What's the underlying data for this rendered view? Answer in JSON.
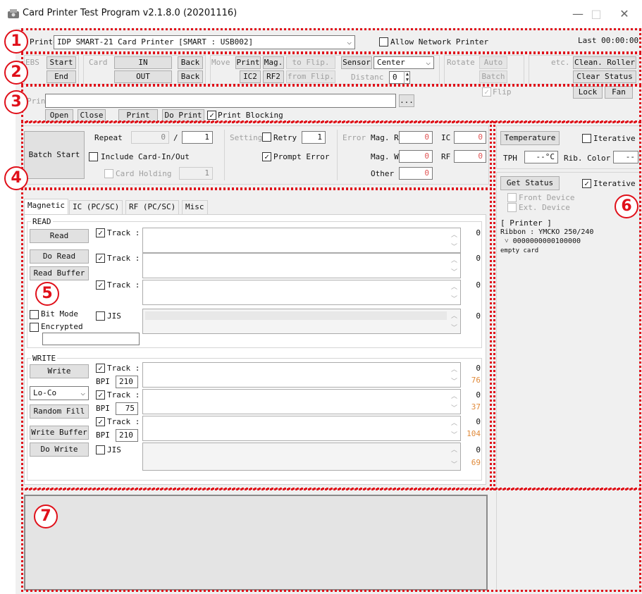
{
  "window": {
    "title": "Card Printer Test Program v2.1.8.0 (20201116)",
    "minimize": "—",
    "maximize": "□",
    "close": "✕"
  },
  "printer_row": {
    "label": "Printer",
    "printer_value": "IDP SMART-21 Card Printer  [SMART : USB002]",
    "allow_network": "Allow Network Printer",
    "last": "Last 00:00:00"
  },
  "row2": {
    "ebs": "EBS",
    "start": "Start",
    "end": "End",
    "card": "Card",
    "in": "IN",
    "out": "OUT",
    "back1": "Back",
    "back2": "Back",
    "move": "Move",
    "print": "Print",
    "mag": "Mag.",
    "to_flip": "to Flip.",
    "ic2": "IC2",
    "rf2": "RF2",
    "from_flip": "from Flip.",
    "sensor": "Sensor",
    "sensor_value": "Center",
    "distance": "Distanc",
    "distance_value": "0",
    "rotate": "Rotate",
    "auto": "Auto",
    "batch": "Batch",
    "flip": "Flip",
    "etc": "etc.",
    "clean_roller": "Clean. Roller",
    "clear_status": "Clear Status",
    "lock": "Lock",
    "fan": "Fan"
  },
  "row3": {
    "label": "Prin",
    "browse": "...",
    "open": "Open",
    "close": "Close",
    "print": "Print",
    "do_print": "Do Print",
    "print_blocking": "Print Blocking"
  },
  "batch": {
    "batch_start": "Batch Start",
    "repeat": "Repeat",
    "repeat_done": "0",
    "slash": "/",
    "repeat_total": "1",
    "include_card": "Include Card-In/Out",
    "card_holding": "Card Holding",
    "card_holding_value": "1",
    "setting": "Setting",
    "retry": "Retry",
    "retry_value": "1",
    "prompt_error": "Prompt Error",
    "error": "Error",
    "mag_r": "Mag. R",
    "mag_r_value": "0",
    "mag_w": "Mag. W",
    "mag_w_value": "0",
    "other": "Other",
    "other_value": "0",
    "ic": "IC",
    "ic_value": "0",
    "rf": "RF",
    "rf_value": "0"
  },
  "tabs": [
    "Magnetic",
    "IC (PC/SC)",
    "RF (PC/SC)",
    "Misc"
  ],
  "read": {
    "group": "READ",
    "read_btn": "Read",
    "do_read": "Do Read",
    "read_buffer": "Read Buffer",
    "track": "Track",
    "colon": ":",
    "counts": [
      "0",
      "0",
      "0",
      "0"
    ],
    "bit_mode": "Bit Mode",
    "encrypted": "Encrypted",
    "jis": "JIS"
  },
  "write": {
    "group": "WRITE",
    "write_btn": "Write",
    "coercivity": "Lo-Co",
    "random_fill": "Random Fill",
    "write_buffer": "Write Buffer",
    "do_write": "Do Write",
    "track": "Track",
    "colon": ":",
    "bpi": "BPI",
    "bpi_values": [
      "210",
      "75",
      "210"
    ],
    "counts": [
      "0",
      "0",
      "0",
      "0"
    ],
    "limits": [
      "76",
      "37",
      "104",
      "69"
    ],
    "jis": "JIS"
  },
  "right": {
    "temperature": "Temperature",
    "iterative1": "Iterative",
    "tph": "TPH",
    "tph_value": "--°C",
    "rib_color": "Rib. Color",
    "rib_color_value": "--",
    "get_status": "Get Status",
    "iterative2": "Iterative",
    "front_device": "Front Device",
    "ext_device": "Ext. Device",
    "status_lines": [
      "[ Printer ]",
      "Ribbon : YMCKO         250/240",
      "˅ 0000000000100000",
      "empty card"
    ]
  },
  "markers": [
    "1",
    "2",
    "3",
    "4",
    "5",
    "6",
    "7"
  ],
  "colors": {
    "annotation": "#e0101a",
    "count_orange": "#e08a3a",
    "error_red": "#e05555"
  }
}
